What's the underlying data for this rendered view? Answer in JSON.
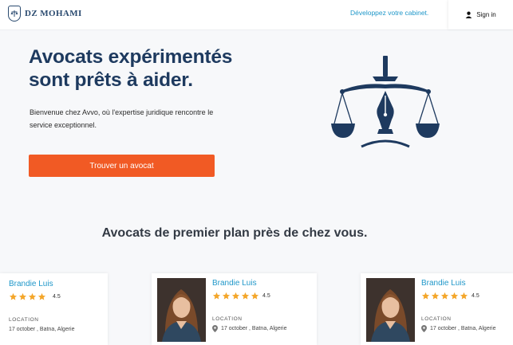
{
  "header": {
    "logo_text": "DZ MOHAMI",
    "develop_link": "Développez votre cabinet.",
    "signin_label": "Sign in"
  },
  "hero": {
    "title_line1": "Avocats expérimentés",
    "title_line2": "sont prêts à aider.",
    "subtitle": "Bienvenue chez Avvo, où l'expertise juridique rencontre le service exceptionnel.",
    "cta_label": "Trouver un avocat"
  },
  "colors": {
    "primary": "#1e3a5f",
    "accent": "#f15a24",
    "link": "#1f97c9",
    "star": "#f4a62a"
  },
  "section": {
    "title": "Avocats de premier plan près de chez vous."
  },
  "lawyers": [
    {
      "name": "Brandie Luis",
      "rating": "4.5",
      "location_label": "LOCATION",
      "location": "17 october , Batna, Algerie"
    },
    {
      "name": "Brandie Luis",
      "rating": "4.5",
      "location_label": "LOCATION",
      "location": "17 october , Batna, Algerie"
    },
    {
      "name": "Brandie Luis",
      "rating": "4.5",
      "location_label": "LOCATION",
      "location": "17 october , Batna, Algerie"
    }
  ],
  "icons": {
    "logo": "shield-scales-icon",
    "signin": "user-icon",
    "hero": "scales-of-justice-icon",
    "star": "star-icon",
    "location": "location-pin-icon"
  }
}
